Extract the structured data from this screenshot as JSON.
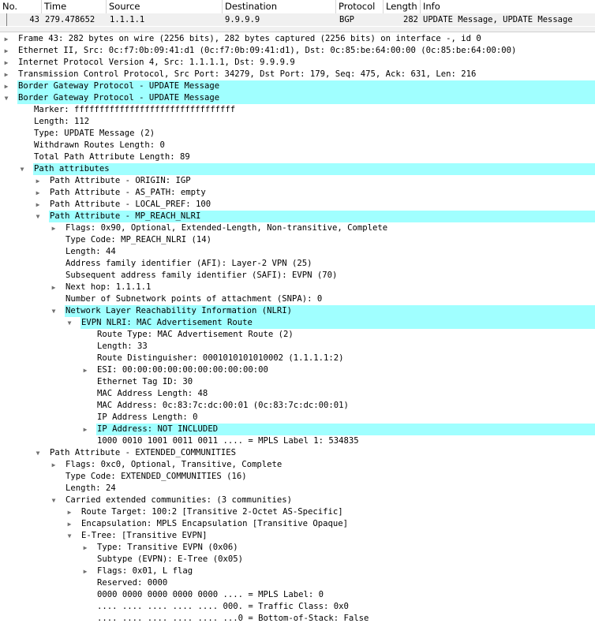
{
  "packet_list": {
    "columns": [
      "No.",
      "Time",
      "Source",
      "Destination",
      "Protocol",
      "Length",
      "Info"
    ],
    "selected_row": {
      "no": "43",
      "time": "279.478652",
      "source": "1.1.1.1",
      "destination": "9.9.9.9",
      "protocol": "BGP",
      "length": "282",
      "info": "UPDATE Message, UPDATE Message"
    }
  },
  "highlight_color": "#a0ffff",
  "icons": {
    "collapsed": "triangle-right-icon",
    "expanded": "triangle-down-icon"
  },
  "tree": [
    {
      "level": 0,
      "state": "collapsed",
      "hl": false,
      "text": "Frame 43: 282 bytes on wire (2256 bits), 282 bytes captured (2256 bits) on interface -, id 0"
    },
    {
      "level": 0,
      "state": "collapsed",
      "hl": false,
      "text": "Ethernet II, Src: 0c:f7:0b:09:41:d1 (0c:f7:0b:09:41:d1), Dst: 0c:85:be:64:00:00 (0c:85:be:64:00:00)"
    },
    {
      "level": 0,
      "state": "collapsed",
      "hl": false,
      "text": "Internet Protocol Version 4, Src: 1.1.1.1, Dst: 9.9.9.9"
    },
    {
      "level": 0,
      "state": "collapsed",
      "hl": false,
      "text": "Transmission Control Protocol, Src Port: 34279, Dst Port: 179, Seq: 475, Ack: 631, Len: 216"
    },
    {
      "level": 0,
      "state": "collapsed",
      "hl": true,
      "text": "Border Gateway Protocol - UPDATE Message"
    },
    {
      "level": 0,
      "state": "expanded",
      "hl": true,
      "text": "Border Gateway Protocol - UPDATE Message"
    },
    {
      "level": 1,
      "state": "leaf",
      "hl": false,
      "text": "Marker: ffffffffffffffffffffffffffffffff"
    },
    {
      "level": 1,
      "state": "leaf",
      "hl": false,
      "text": "Length: 112"
    },
    {
      "level": 1,
      "state": "leaf",
      "hl": false,
      "text": "Type: UPDATE Message (2)"
    },
    {
      "level": 1,
      "state": "leaf",
      "hl": false,
      "text": "Withdrawn Routes Length: 0"
    },
    {
      "level": 1,
      "state": "leaf",
      "hl": false,
      "text": "Total Path Attribute Length: 89"
    },
    {
      "level": 1,
      "state": "expanded",
      "hl": true,
      "text": "Path attributes"
    },
    {
      "level": 2,
      "state": "collapsed",
      "hl": false,
      "text": "Path Attribute - ORIGIN: IGP"
    },
    {
      "level": 2,
      "state": "collapsed",
      "hl": false,
      "text": "Path Attribute - AS_PATH: empty"
    },
    {
      "level": 2,
      "state": "collapsed",
      "hl": false,
      "text": "Path Attribute - LOCAL_PREF: 100"
    },
    {
      "level": 2,
      "state": "expanded",
      "hl": true,
      "text": "Path Attribute - MP_REACH_NLRI"
    },
    {
      "level": 3,
      "state": "collapsed",
      "hl": false,
      "text": "Flags: 0x90, Optional, Extended-Length, Non-transitive, Complete"
    },
    {
      "level": 3,
      "state": "leaf",
      "hl": false,
      "text": "Type Code: MP_REACH_NLRI (14)"
    },
    {
      "level": 3,
      "state": "leaf",
      "hl": false,
      "text": "Length: 44"
    },
    {
      "level": 3,
      "state": "leaf",
      "hl": false,
      "text": "Address family identifier (AFI): Layer-2 VPN (25)"
    },
    {
      "level": 3,
      "state": "leaf",
      "hl": false,
      "text": "Subsequent address family identifier (SAFI): EVPN (70)"
    },
    {
      "level": 3,
      "state": "collapsed",
      "hl": false,
      "text": "Next hop: 1.1.1.1"
    },
    {
      "level": 3,
      "state": "leaf",
      "hl": false,
      "text": "Number of Subnetwork points of attachment (SNPA): 0"
    },
    {
      "level": 3,
      "state": "expanded",
      "hl": true,
      "text": "Network Layer Reachability Information (NLRI)"
    },
    {
      "level": 4,
      "state": "expanded",
      "hl": true,
      "text": "EVPN NLRI: MAC Advertisement Route"
    },
    {
      "level": 5,
      "state": "leaf",
      "hl": false,
      "text": "Route Type: MAC Advertisement Route (2)"
    },
    {
      "level": 5,
      "state": "leaf",
      "hl": false,
      "text": "Length: 33"
    },
    {
      "level": 5,
      "state": "leaf",
      "hl": false,
      "text": "Route Distinguisher: 0001010101010002 (1.1.1.1:2)"
    },
    {
      "level": 5,
      "state": "collapsed",
      "hl": false,
      "text": "ESI: 00:00:00:00:00:00:00:00:00:00"
    },
    {
      "level": 5,
      "state": "leaf",
      "hl": false,
      "text": "Ethernet Tag ID: 30"
    },
    {
      "level": 5,
      "state": "leaf",
      "hl": false,
      "text": "MAC Address Length: 48"
    },
    {
      "level": 5,
      "state": "leaf",
      "hl": false,
      "text": "MAC Address: 0c:83:7c:dc:00:01 (0c:83:7c:dc:00:01)"
    },
    {
      "level": 5,
      "state": "leaf",
      "hl": false,
      "text": "IP Address Length: 0"
    },
    {
      "level": 5,
      "state": "collapsed",
      "hl": true,
      "text": "IP Address: NOT INCLUDED"
    },
    {
      "level": 5,
      "state": "leaf",
      "hl": false,
      "text": "1000 0010 1001 0011 0011 .... = MPLS Label 1: 534835"
    },
    {
      "level": 2,
      "state": "expanded",
      "hl": false,
      "text": "Path Attribute - EXTENDED_COMMUNITIES"
    },
    {
      "level": 3,
      "state": "collapsed",
      "hl": false,
      "text": "Flags: 0xc0, Optional, Transitive, Complete"
    },
    {
      "level": 3,
      "state": "leaf",
      "hl": false,
      "text": "Type Code: EXTENDED_COMMUNITIES (16)"
    },
    {
      "level": 3,
      "state": "leaf",
      "hl": false,
      "text": "Length: 24"
    },
    {
      "level": 3,
      "state": "expanded",
      "hl": false,
      "text": "Carried extended communities: (3 communities)"
    },
    {
      "level": 4,
      "state": "collapsed",
      "hl": false,
      "text": "Route Target: 100:2 [Transitive 2-Octet AS-Specific]"
    },
    {
      "level": 4,
      "state": "collapsed",
      "hl": false,
      "text": "Encapsulation: MPLS Encapsulation [Transitive Opaque]"
    },
    {
      "level": 4,
      "state": "expanded",
      "hl": false,
      "text": "E-Tree: [Transitive EVPN]"
    },
    {
      "level": 5,
      "state": "collapsed",
      "hl": false,
      "text": "Type: Transitive EVPN (0x06)"
    },
    {
      "level": 5,
      "state": "leaf",
      "hl": false,
      "text": "Subtype (EVPN): E-Tree (0x05)"
    },
    {
      "level": 5,
      "state": "collapsed",
      "hl": false,
      "text": "Flags: 0x01, L flag"
    },
    {
      "level": 5,
      "state": "leaf",
      "hl": false,
      "text": "Reserved: 0000"
    },
    {
      "level": 5,
      "state": "leaf",
      "hl": false,
      "text": "0000 0000 0000 0000 0000 .... = MPLS Label: 0"
    },
    {
      "level": 5,
      "state": "leaf",
      "hl": false,
      "text": ".... .... .... .... .... 000. = Traffic Class: 0x0"
    },
    {
      "level": 5,
      "state": "leaf",
      "hl": false,
      "text": ".... .... .... .... .... ...0 = Bottom-of-Stack: False"
    }
  ]
}
